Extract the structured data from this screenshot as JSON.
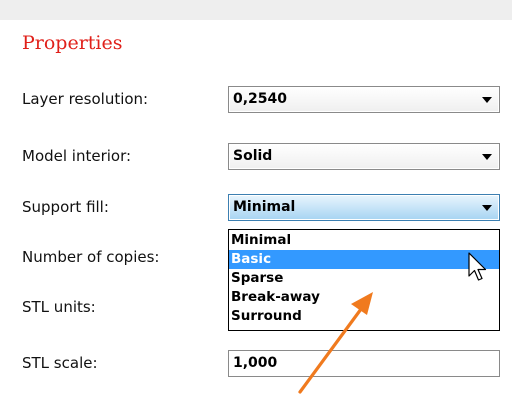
{
  "panel": {
    "title": "Properties"
  },
  "fields": {
    "layer_resolution": {
      "label": "Layer resolution:",
      "value": "0,2540"
    },
    "model_interior": {
      "label": "Model interior:",
      "value": "Solid"
    },
    "support_fill": {
      "label": "Support fill:",
      "value": "Minimal",
      "options": [
        "Minimal",
        "Basic",
        "Sparse",
        "Break-away",
        "Surround"
      ],
      "highlighted": "Basic"
    },
    "number_of_copies": {
      "label": "Number of copies:"
    },
    "stl_units": {
      "label": "STL units:"
    },
    "stl_scale": {
      "label": "STL scale:",
      "value": "1,000"
    }
  },
  "colors": {
    "title": "#e0201a",
    "highlight": "#3399ff",
    "annotation_arrow": "#f07a1e"
  },
  "icons": [
    "chevron-down-icon",
    "mouse-pointer-icon",
    "annotation-arrow"
  ]
}
